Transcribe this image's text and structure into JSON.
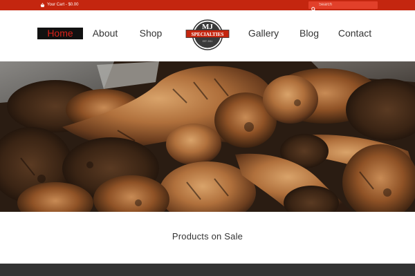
{
  "topbar": {
    "cart_label": "Your Cart - $0.00",
    "search_placeholder": "Search"
  },
  "nav": {
    "items": [
      {
        "label": "Home",
        "active": true
      },
      {
        "label": "About"
      },
      {
        "label": "Shop"
      },
      {
        "label": "Gallery"
      },
      {
        "label": "Blog"
      },
      {
        "label": "Contact"
      }
    ]
  },
  "logo": {
    "line1": "MJ",
    "line2": "SPECIALTIES",
    "line3": "EST. 2011"
  },
  "hero": {
    "image": "grilled chicken pieces photo"
  },
  "products": {
    "heading": "Products on Sale"
  },
  "colors": {
    "topbar": "#c4260f",
    "accent": "#d9221a",
    "nav_active_bg": "#111111",
    "text": "#333333",
    "footer": "#333333"
  },
  "icons": {
    "cart": "basket-icon",
    "search": "search-icon"
  }
}
